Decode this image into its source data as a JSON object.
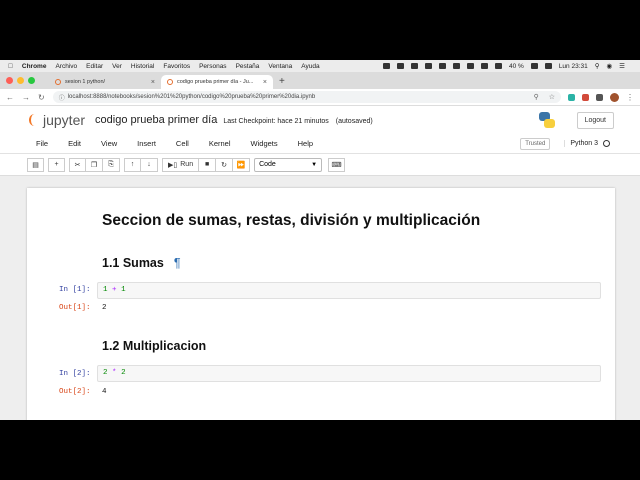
{
  "menubar": {
    "app": "Chrome",
    "items": [
      "Archivo",
      "Editar",
      "Ver",
      "Historial",
      "Favoritos",
      "Personas",
      "Pestaña",
      "Ventana",
      "Ayuda"
    ],
    "battery": "40 %",
    "clock": "Lun 23:31"
  },
  "browser": {
    "tabs": [
      {
        "label": "sesion 1 python/"
      },
      {
        "label": "codigo prueba primer día - Ju..."
      }
    ],
    "url": "localhost:8888/notebooks/sesion%201%20python/codigo%20prueba%20primer%20dia.ipynb"
  },
  "jupyter": {
    "logo_text": "jupyter",
    "notebook_title": "codigo prueba primer día",
    "checkpoint": "Last Checkpoint: hace 21 minutos",
    "autosave": "(autosaved)",
    "logout": "Logout",
    "menu": [
      "File",
      "Edit",
      "View",
      "Insert",
      "Cell",
      "Kernel",
      "Widgets",
      "Help"
    ],
    "trusted": "Trusted",
    "kernel_name": "Python 3",
    "toolbar": {
      "run_label": "Run",
      "cell_type": "Code"
    }
  },
  "notebook": {
    "heading1": "Seccion de sumas, restas, división y multiplicación",
    "section1": {
      "title": "1.1 Sumas",
      "anchor": "¶"
    },
    "cell1": {
      "in_prompt": "In [1]:",
      "code_a": "1",
      "code_op": "+",
      "code_b": "1",
      "out_prompt": "Out[1]:",
      "output": "2"
    },
    "section2": {
      "title": "1.2 Multiplicacion"
    },
    "cell2": {
      "in_prompt": "In [2]:",
      "code_a": "2",
      "code_op": "*",
      "code_b": "2",
      "out_prompt": "Out[2]:",
      "output": "4"
    }
  }
}
